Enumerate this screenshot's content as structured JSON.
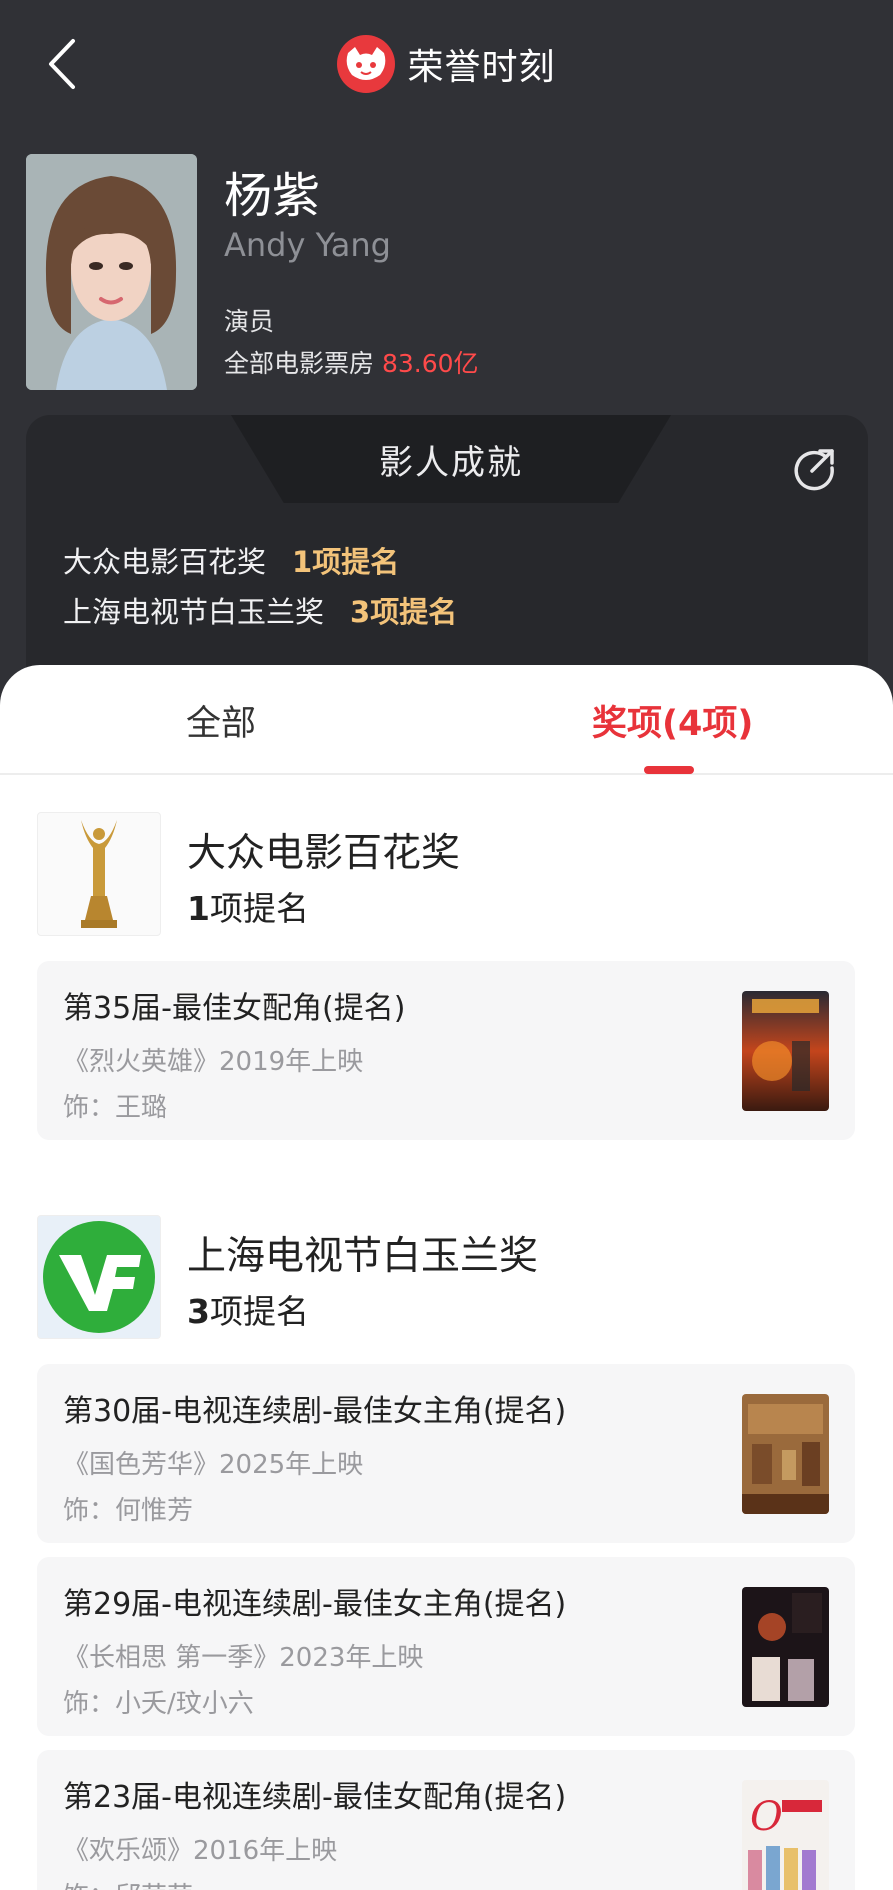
{
  "header": {
    "title": "荣誉时刻"
  },
  "profile": {
    "name": "杨紫",
    "english_name": "Andy Yang",
    "role": "演员",
    "box_office_label": "全部电影票房 ",
    "box_office_value": "83.60亿"
  },
  "achievements": {
    "title": "影人成就",
    "items": [
      {
        "award": "大众电影百花奖",
        "count": "1项提名"
      },
      {
        "award": "上海电视节白玉兰奖",
        "count": "3项提名"
      }
    ]
  },
  "tabs": {
    "all": "全部",
    "awards": "奖项(4项)"
  },
  "groups": [
    {
      "name": "大众电影百花奖",
      "count_num": "1",
      "count_text": "项提名",
      "logo_icon": "trophy-icon"
    },
    {
      "name": "上海电视节白玉兰奖",
      "count_num": "3",
      "count_text": "项提名",
      "logo_icon": "vf-logo-icon"
    }
  ],
  "cards": [
    {
      "title": "第35届-最佳女配角(提名)",
      "work": "《烈火英雄》2019年上映",
      "role": "饰：王璐"
    },
    {
      "title": "第30届-电视连续剧-最佳女主角(提名)",
      "work": "《国色芳华》2025年上映",
      "role": "饰：何惟芳"
    },
    {
      "title": "第29届-电视连续剧-最佳女主角(提名)",
      "work": "《长相思 第一季》2023年上映",
      "role": "饰：小夭/玟小六"
    },
    {
      "title": "第23届-电视连续剧-最佳女配角(提名)",
      "work": "《欢乐颂》2016年上映",
      "role": "饰：邱莹莹"
    }
  ],
  "colors": {
    "accent_red": "#e8333a",
    "gold": "#f3c37a",
    "dark_bg": "#303136"
  }
}
